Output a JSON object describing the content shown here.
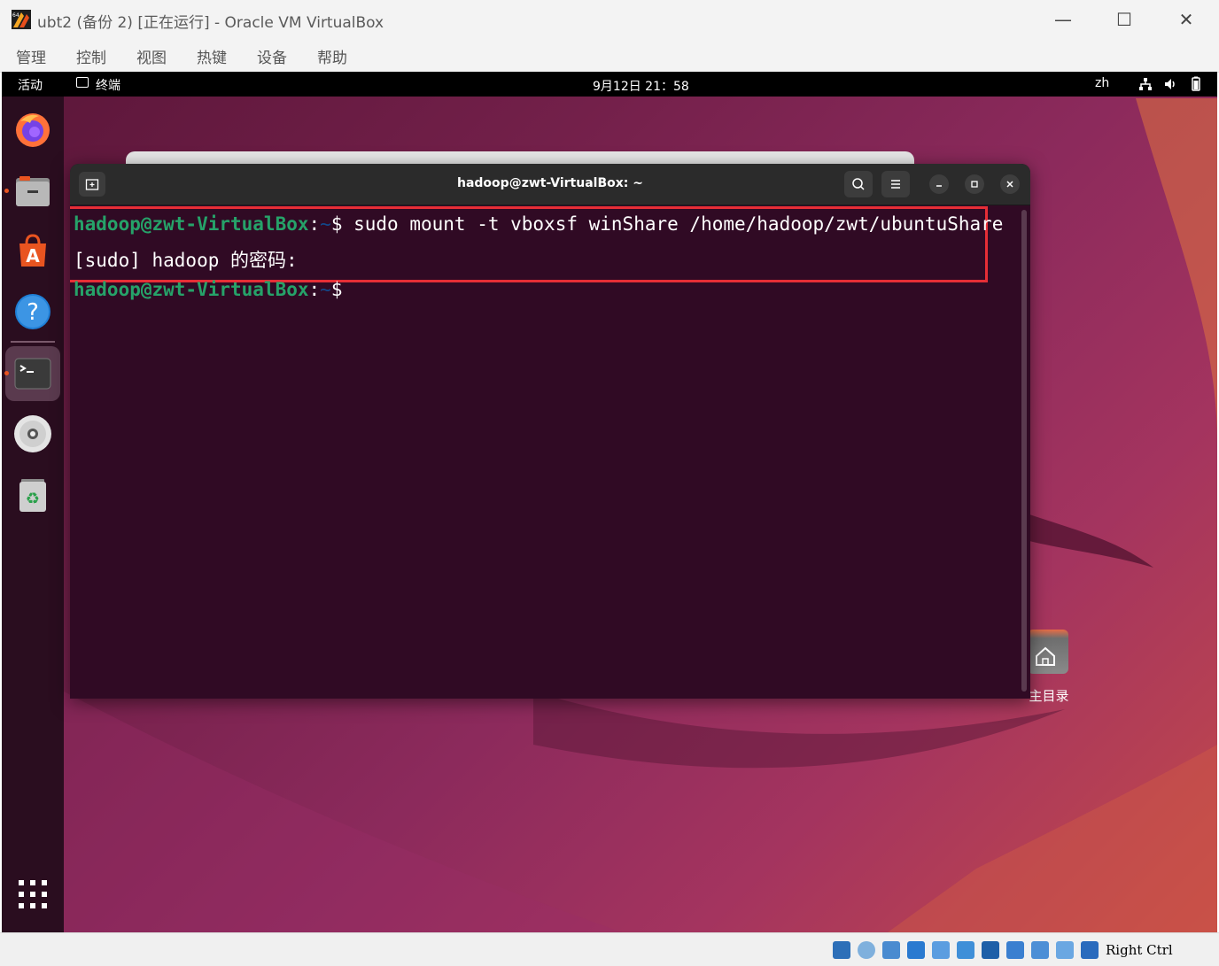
{
  "window": {
    "title": "ubt2 (备份 2) [正在运行] - Oracle VM VirtualBox",
    "controls": {
      "minimize": "—",
      "maximize": "☐",
      "close": "✕"
    }
  },
  "menu": {
    "items": [
      "管理",
      "控制",
      "视图",
      "热键",
      "设备",
      "帮助"
    ]
  },
  "topbar": {
    "activities": "活动",
    "app_name": "终端",
    "datetime": "9月12日  21：58",
    "input_method": "zh"
  },
  "terminal": {
    "title": "hadoop@zwt-VirtualBox: ~",
    "lines": [
      {
        "user": "hadoop@zwt-VirtualBox",
        "sep": ":",
        "path": "~",
        "prompt": "$",
        "command": " sudo mount -t vboxsf winShare /home/hadoop/zwt/ubuntuShare"
      },
      {
        "text": "[sudo] hadoop 的密码:"
      },
      {
        "user": "hadoop@zwt-VirtualBox",
        "sep": ":",
        "path": "~",
        "prompt": "$",
        "command": ""
      }
    ]
  },
  "desktop": {
    "home_icon_label": "主目录"
  },
  "statusbar": {
    "host_key": "Right Ctrl"
  },
  "colors": {
    "prompt_user": "#26a269",
    "prompt_path": "#12488b",
    "terminal_bg": "#300a24",
    "highlight_border": "#e62e36"
  }
}
